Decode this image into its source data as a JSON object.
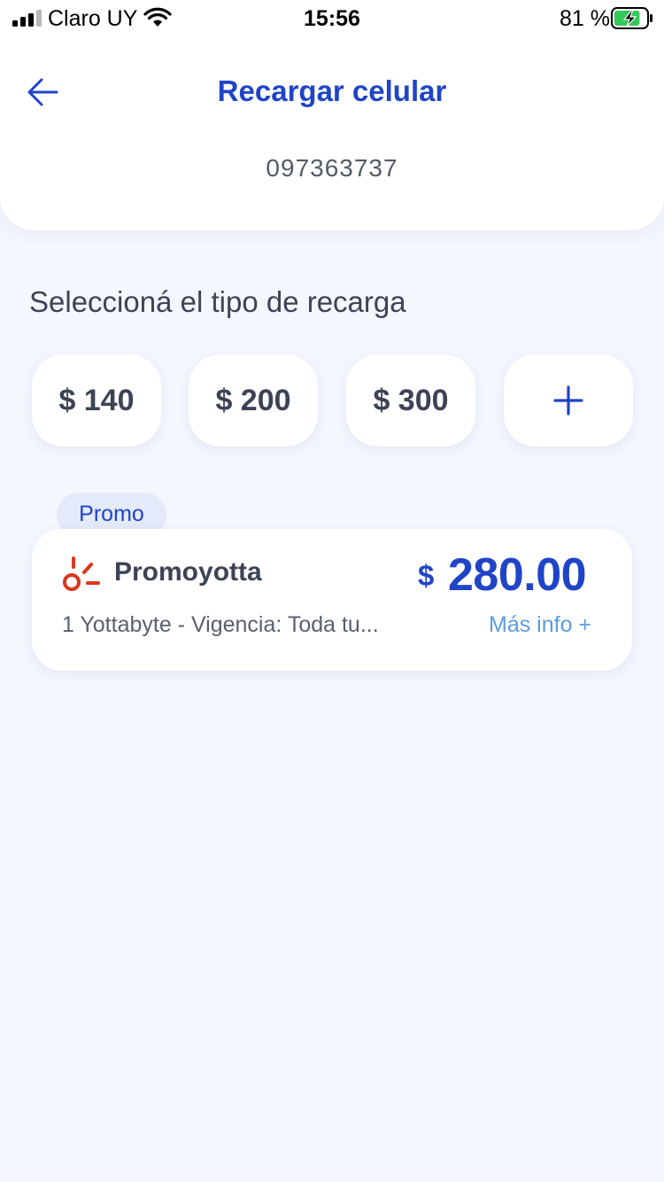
{
  "status_bar": {
    "carrier": "Claro UY",
    "time": "15:56",
    "battery_percent": "81 %",
    "battery_level": 0.81
  },
  "header": {
    "title": "Recargar celular",
    "phone_number": "097363737"
  },
  "recharge": {
    "section_title": "Seleccioná el tipo de recarga",
    "amounts": [
      "$ 140",
      "$ 200",
      "$ 300"
    ],
    "custom_amount_label": "+"
  },
  "promo": {
    "badge": "Promo",
    "name": "Promoyotta",
    "currency": "$",
    "price": "280.00",
    "description": "1 Yottabyte - Vigencia: Toda tu...",
    "more_info": "Más info +"
  },
  "colors": {
    "accent": "#1f44c8",
    "link": "#5b9be0",
    "logo_red": "#d9381e",
    "background": "#f4f7fe"
  },
  "icons": [
    "signal-icon",
    "wifi-icon",
    "battery-charging-icon",
    "back-arrow-icon",
    "promo-logo-icon"
  ]
}
